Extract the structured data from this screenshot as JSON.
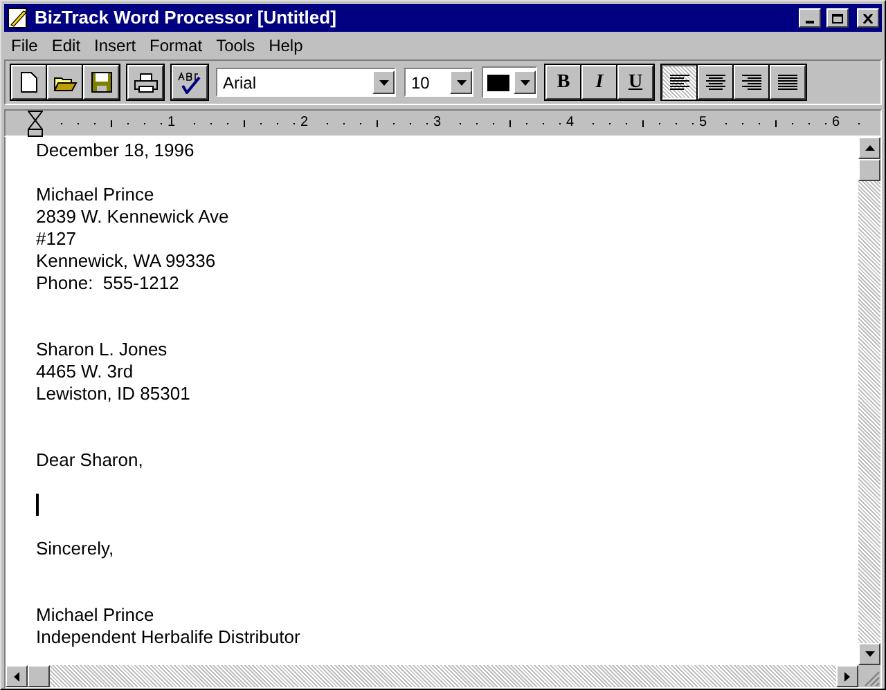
{
  "window": {
    "title": "BizTrack Word Processor [Untitled]"
  },
  "menu": [
    {
      "label": "File"
    },
    {
      "label": "Edit"
    },
    {
      "label": "Insert"
    },
    {
      "label": "Format"
    },
    {
      "label": "Tools"
    },
    {
      "label": "Help"
    }
  ],
  "toolbar": {
    "font": "Arial",
    "size": "10",
    "color": "#000000",
    "styles": [
      {
        "label": "B",
        "kind": "bold"
      },
      {
        "label": "I",
        "kind": "italic"
      },
      {
        "label": "U",
        "kind": "underline"
      }
    ],
    "alignments": [
      {
        "kind": "left",
        "selected": true
      },
      {
        "kind": "center",
        "selected": false
      },
      {
        "kind": "right",
        "selected": false
      },
      {
        "kind": "justify",
        "selected": false
      }
    ]
  },
  "ruler": {
    "marks": [
      "1",
      "2",
      "3",
      "4",
      "5",
      "6"
    ]
  },
  "document": {
    "lines": [
      {
        "kind": "text",
        "text": "December 18, 1996"
      },
      {
        "kind": "blank"
      },
      {
        "kind": "text",
        "text": "Michael Prince"
      },
      {
        "kind": "text",
        "text": "2839 W. Kennewick Ave"
      },
      {
        "kind": "text",
        "text": "#127"
      },
      {
        "kind": "text",
        "text": "Kennewick, WA 99336"
      },
      {
        "kind": "text",
        "text": "Phone:  555-1212"
      },
      {
        "kind": "blank"
      },
      {
        "kind": "blank"
      },
      {
        "kind": "text",
        "text": "Sharon L. Jones"
      },
      {
        "kind": "text",
        "text": "4465 W. 3rd"
      },
      {
        "kind": "text",
        "text": "Lewiston, ID 85301"
      },
      {
        "kind": "blank"
      },
      {
        "kind": "blank"
      },
      {
        "kind": "text",
        "text": "Dear Sharon,"
      },
      {
        "kind": "blank"
      },
      {
        "kind": "cursor"
      },
      {
        "kind": "blank"
      },
      {
        "kind": "text",
        "text": "Sincerely,"
      },
      {
        "kind": "blank"
      },
      {
        "kind": "blank"
      },
      {
        "kind": "text",
        "text": "Michael Prince"
      },
      {
        "kind": "text",
        "text": "Independent Herbalife Distributor"
      }
    ]
  }
}
